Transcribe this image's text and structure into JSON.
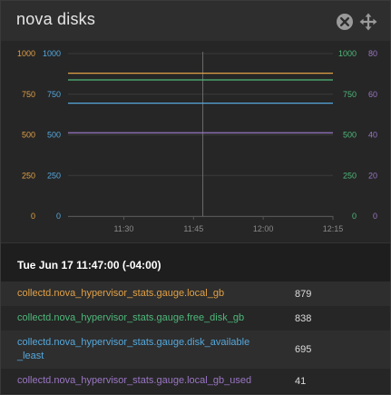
{
  "widget": {
    "title": "nova disks",
    "icons": {
      "close": "close-circle-icon",
      "move": "move-arrows-icon"
    }
  },
  "colors": {
    "local_gb": "#e0a046",
    "free_disk_gb": "#4fb87a",
    "disk_available_least": "#55a8dc",
    "local_gb_used": "#9a76c4",
    "grid": "#3a3a3a",
    "axis": "#8a8a8a",
    "cursor": "#6a6a6a"
  },
  "chart_data": {
    "type": "line",
    "x": [
      "11:30",
      "11:45",
      "12:00",
      "12:15"
    ],
    "xlim": [
      "11:18",
      "12:15"
    ],
    "cursor_time": "11:47",
    "axes": [
      {
        "id": "a",
        "side": "left",
        "color": "#e0a046",
        "ticks": [
          "1000",
          "750",
          "500",
          "250",
          "0"
        ],
        "ylim": [
          0,
          1000
        ]
      },
      {
        "id": "b",
        "side": "left",
        "color": "#55a8dc",
        "ticks": [
          "1000",
          "750",
          "500",
          "250",
          "0"
        ],
        "ylim": [
          0,
          1000
        ]
      },
      {
        "id": "c",
        "side": "right",
        "color": "#4fb87a",
        "ticks": [
          "1000",
          "750",
          "500",
          "250",
          "0"
        ],
        "ylim": [
          0,
          1000
        ]
      },
      {
        "id": "d",
        "side": "right",
        "color": "#9a76c4",
        "ticks": [
          "80",
          "60",
          "40",
          "20",
          "0"
        ],
        "ylim": [
          0,
          80
        ]
      }
    ],
    "series": [
      {
        "name": "collectd.nova_hypervisor_stats.gauge.local_gb",
        "axis": "a",
        "color": "#e0a046",
        "values": [
          879,
          879,
          879,
          879
        ]
      },
      {
        "name": "collectd.nova_hypervisor_stats.gauge.free_disk_gb",
        "axis": "c",
        "color": "#4fb87a",
        "values": [
          838,
          838,
          838,
          838
        ]
      },
      {
        "name": "collectd.nova_hypervisor_stats.gauge.disk_available_least",
        "axis": "b",
        "color": "#55a8dc",
        "values": [
          695,
          695,
          695,
          695
        ]
      },
      {
        "name": "collectd.nova_hypervisor_stats.gauge.local_gb_used",
        "axis": "d",
        "color": "#9a76c4",
        "values": [
          41,
          41,
          41,
          41
        ]
      }
    ]
  },
  "legend": {
    "timestamp": "Tue Jun 17 11:47:00 (-04:00)",
    "rows": [
      {
        "name": "collectd.nova_hypervisor_stats.gauge.local_gb",
        "value": "879",
        "color": "#e0a046"
      },
      {
        "name": "collectd.nova_hypervisor_stats.gauge.free_disk_gb",
        "value": "838",
        "color": "#4fb87a"
      },
      {
        "name": "collectd.nova_hypervisor_stats.gauge.disk_available_least",
        "value": "695",
        "color": "#55a8dc"
      },
      {
        "name": "collectd.nova_hypervisor_stats.gauge.local_gb_used",
        "value": "41",
        "color": "#9a76c4"
      }
    ]
  }
}
